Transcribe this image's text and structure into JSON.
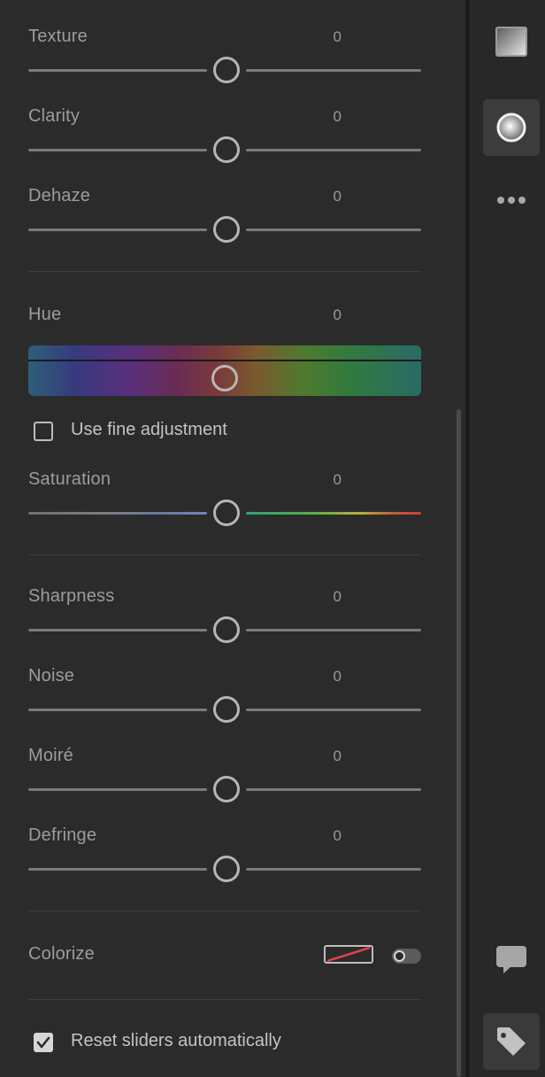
{
  "panel": {
    "texture": {
      "label": "Texture",
      "value": "0",
      "level": 0.5
    },
    "clarity": {
      "label": "Clarity",
      "value": "0",
      "level": 0.5
    },
    "dehaze": {
      "label": "Dehaze",
      "value": "0",
      "level": 0.5
    },
    "hue": {
      "label": "Hue",
      "value": "0",
      "level": 0.5
    },
    "fine_adjustment": {
      "label": "Use fine adjustment",
      "checked": false
    },
    "saturation": {
      "label": "Saturation",
      "value": "0",
      "level": 0.5
    },
    "sharpness": {
      "label": "Sharpness",
      "value": "0",
      "level": 0.5
    },
    "noise": {
      "label": "Noise",
      "value": "0",
      "level": 0.5
    },
    "moire": {
      "label": "Moiré",
      "value": "0",
      "level": 0.5
    },
    "defringe": {
      "label": "Defringe",
      "value": "0",
      "level": 0.5
    },
    "colorize": {
      "label": "Colorize",
      "enabled": false
    },
    "reset_sliders": {
      "label": "Reset sliders automatically",
      "checked": true
    }
  },
  "rail": {
    "icons": [
      "gradient-icon",
      "radial-icon",
      "more-icon",
      "comment-icon",
      "tag-icon"
    ]
  },
  "colors": {
    "accent_red": "#e0444a",
    "background": "#2b2b2b"
  }
}
